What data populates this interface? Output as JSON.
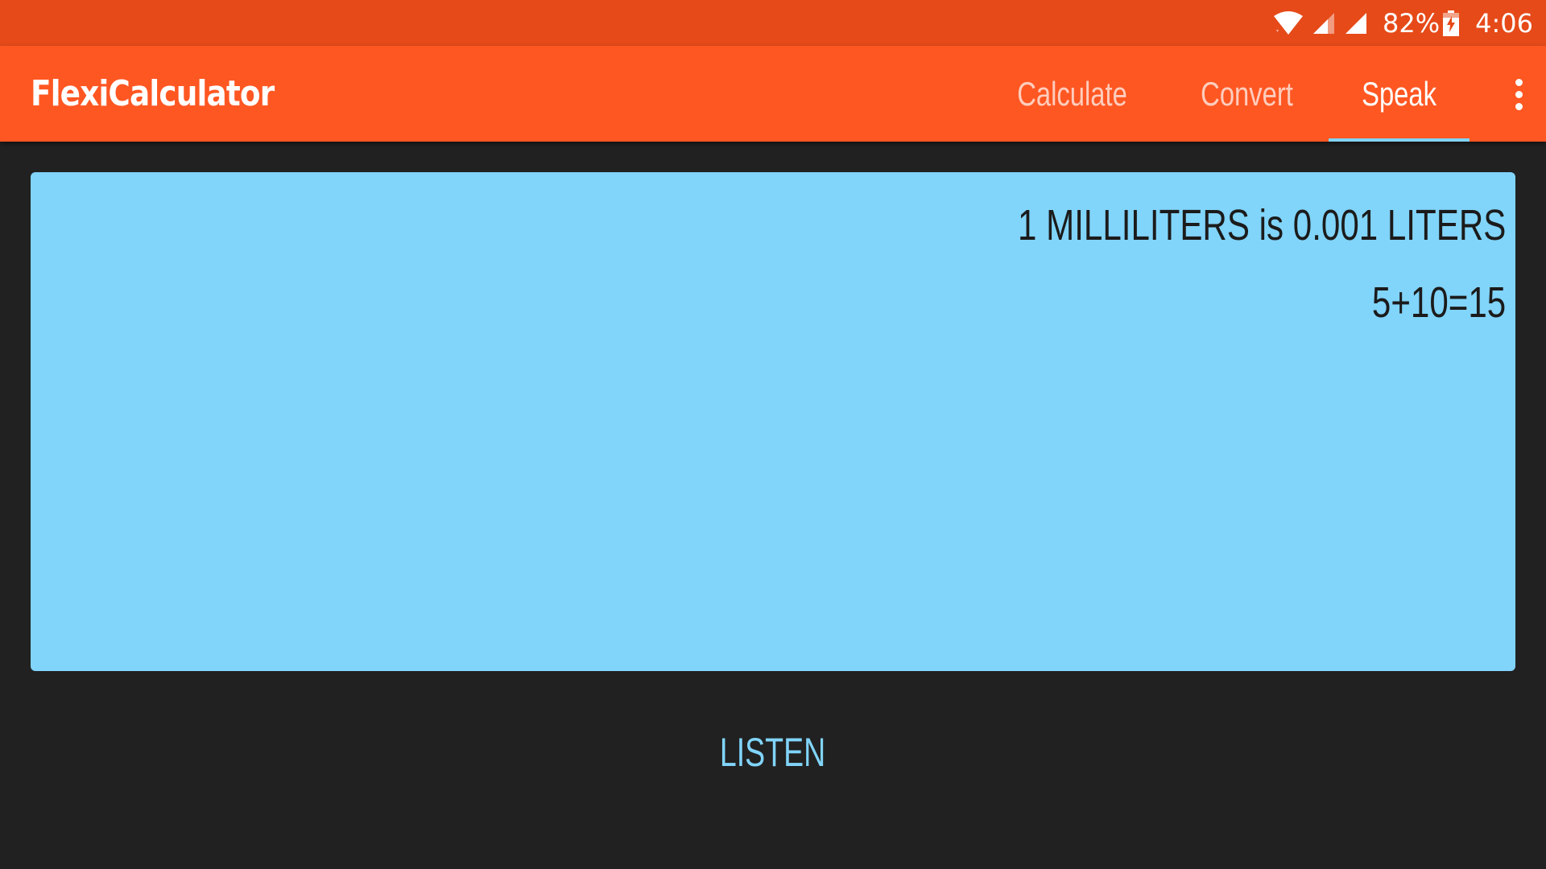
{
  "status_bar": {
    "battery_percent": "82%",
    "time": "4:06",
    "icons": [
      "wifi-icon",
      "cell-signal-icon",
      "cell-signal-icon",
      "battery-charging-icon"
    ]
  },
  "app_bar": {
    "title": "FlexiCalculator",
    "tabs": [
      {
        "label": "Calculate",
        "active": false
      },
      {
        "label": "Convert",
        "active": false
      },
      {
        "label": "Speak",
        "active": true
      }
    ],
    "overflow_icon": "more-vert-icon"
  },
  "output": {
    "lines": [
      "1 MILLILITERS is 0.001 LITERS",
      "5+10=15"
    ]
  },
  "listen_button": {
    "label": "LISTEN"
  },
  "colors": {
    "status_bar": "#E64A19",
    "app_bar": "#FF5722",
    "background": "#212121",
    "accent": "#81D4FA",
    "panel": "#81D4FA"
  }
}
